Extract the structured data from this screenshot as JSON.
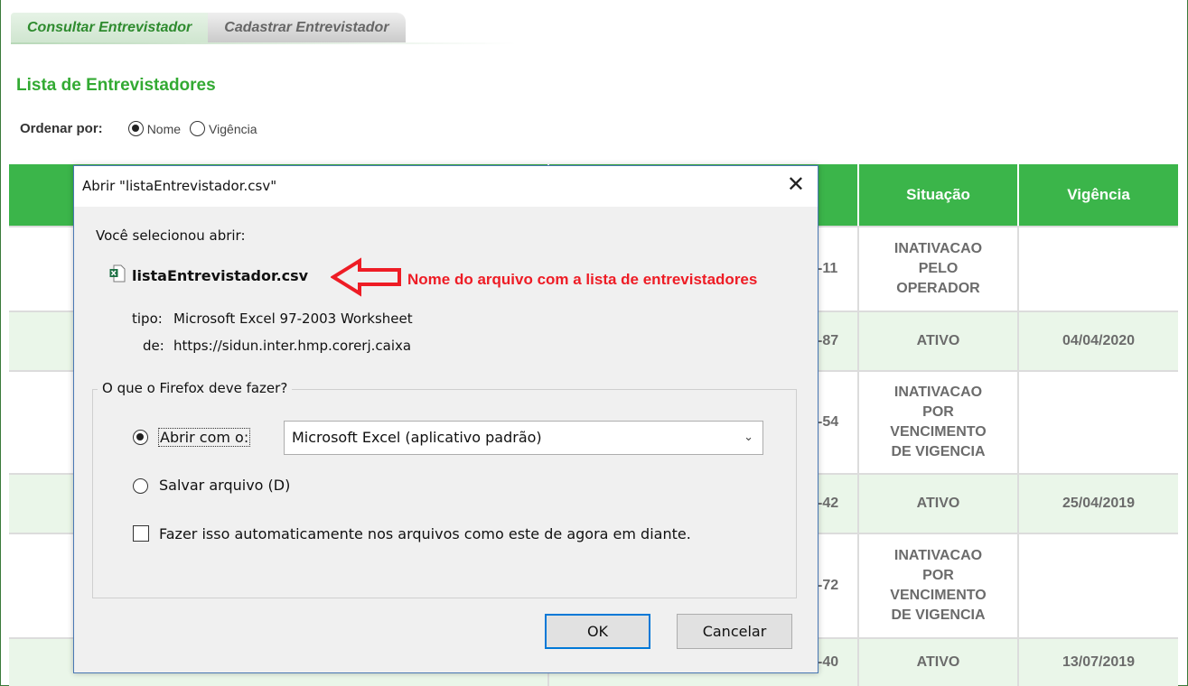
{
  "tabs": {
    "consultar": "Consultar Entrevistador",
    "cadastrar": "Cadastrar Entrevistador"
  },
  "section_title": "Lista de Entrevistadores",
  "sort": {
    "label": "Ordenar por:",
    "option_nome": "Nome",
    "option_vigencia": "Vigência",
    "selected": "Nome"
  },
  "table": {
    "headers": {
      "situacao": "Situação",
      "vigencia": "Vigência"
    },
    "rows": [
      {
        "num": "-11",
        "situacao_lines": [
          "INATIVACAO",
          "PELO",
          "OPERADOR"
        ],
        "vigencia": ""
      },
      {
        "num": "-87",
        "situacao_lines": [
          "ATIVO"
        ],
        "vigencia": "04/04/2020"
      },
      {
        "num": "-54",
        "situacao_lines": [
          "INATIVACAO",
          "POR",
          "VENCIMENTO",
          "DE VIGENCIA"
        ],
        "vigencia": ""
      },
      {
        "num": "-42",
        "situacao_lines": [
          "ATIVO"
        ],
        "vigencia": "25/04/2019"
      },
      {
        "num": "-72",
        "situacao_lines": [
          "INATIVACAO",
          "POR",
          "VENCIMENTO",
          "DE VIGENCIA"
        ],
        "vigencia": ""
      },
      {
        "num": "-40",
        "situacao_lines": [
          "ATIVO"
        ],
        "vigencia": "13/07/2019"
      }
    ]
  },
  "dialog": {
    "title": "Abrir \"listaEntrevistador.csv\"",
    "close_glyph": "✕",
    "you_selected": "Você selecionou abrir:",
    "file_name": "listaEntrevistador.csv",
    "type_label": "tipo:",
    "type_value": "Microsoft Excel 97-2003 Worksheet",
    "from_label": "de:",
    "from_value": "https://sidun.inter.hmp.corerj.caixa",
    "group_title": "O que o Firefox deve fazer?",
    "open_with_label": "Abrir com o:",
    "open_with_app": "Microsoft Excel (aplicativo padrão)",
    "save_file_label": "Salvar arquivo (D)",
    "auto_label": "Fazer isso automaticamente nos arquivos como este de agora em diante.",
    "ok_label": "OK",
    "cancel_label": "Cancelar"
  },
  "annotation": {
    "text": "Nome do arquivo com a lista de entrevistadores",
    "color": "#ee1c25"
  },
  "colors": {
    "header_green": "#3bb54a",
    "row_alt": "#eaf6e9",
    "title_green": "#33aa33"
  },
  "icons": {
    "file": "excel-file-icon",
    "close": "close-icon",
    "dropdown": "chevron-down-icon",
    "arrow": "red-arrow"
  }
}
